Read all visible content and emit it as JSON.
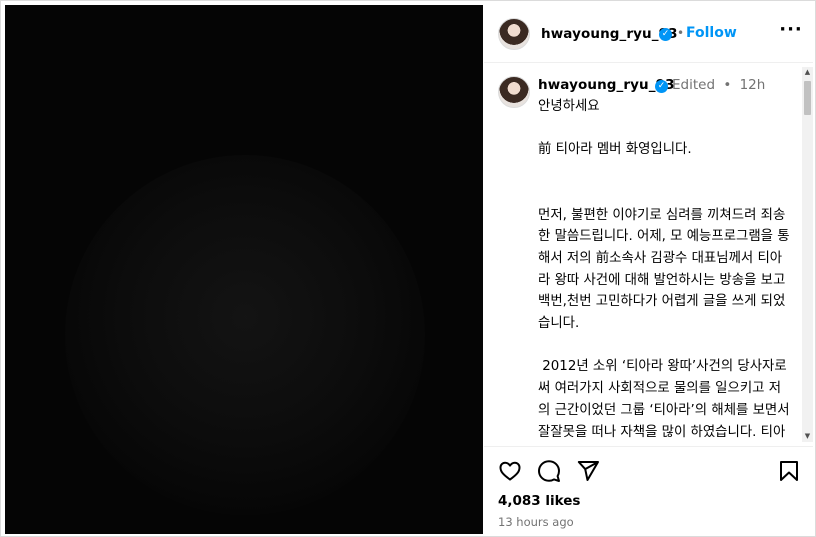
{
  "post": {
    "username": "hwayoung_ryu_93",
    "follow_label": "Follow",
    "separator": "•",
    "more_label": "···",
    "verified_mark": "✓"
  },
  "caption": {
    "username": "hwayoung_ryu_93",
    "edited_label": "Edited",
    "separator": "•",
    "timestamp": "12h",
    "paragraphs": [
      "안녕하세요\n\n前 티아라 멤버 화영입니다.\n\n\n먼저, 불편한 이야기로 심려를 끼쳐드려 죄송한 말씀드립니다. 어제, 모 예능프로그램을 통해서 저의 前소속사 김광수 대표님께서 티아라 왕따 사건에 대해 발언하시는 방송을 보고 백번,천번 고민하다가 어렵게 글을 쓰게 되었습니다.\n\n 2012년 소위 ‘티아라 왕따’사건의 당사자로써 여러가지 사회적으로 물의를 일으키고 저의 근간이었던 그룹 ‘티아라’의 해체를 보면서 잘잘못을 떠나 자책을 많이 하였습니다. 티아라를 사랑했던 모든 팬들과 비록 왕따, 불화라는 단어로 헤어졌던 멤버들에게도 항상 미안한 마음을 가지고 살고 있었습니다."
    ]
  },
  "footer": {
    "likes": "4,083 likes",
    "time_ago": "13 hours ago"
  },
  "icons": {
    "like": "heart-icon",
    "comment": "comment-icon",
    "share": "share-icon",
    "save": "bookmark-icon"
  },
  "colors": {
    "accent": "#0095f6",
    "muted": "#737373",
    "media_bg": "#050505"
  }
}
